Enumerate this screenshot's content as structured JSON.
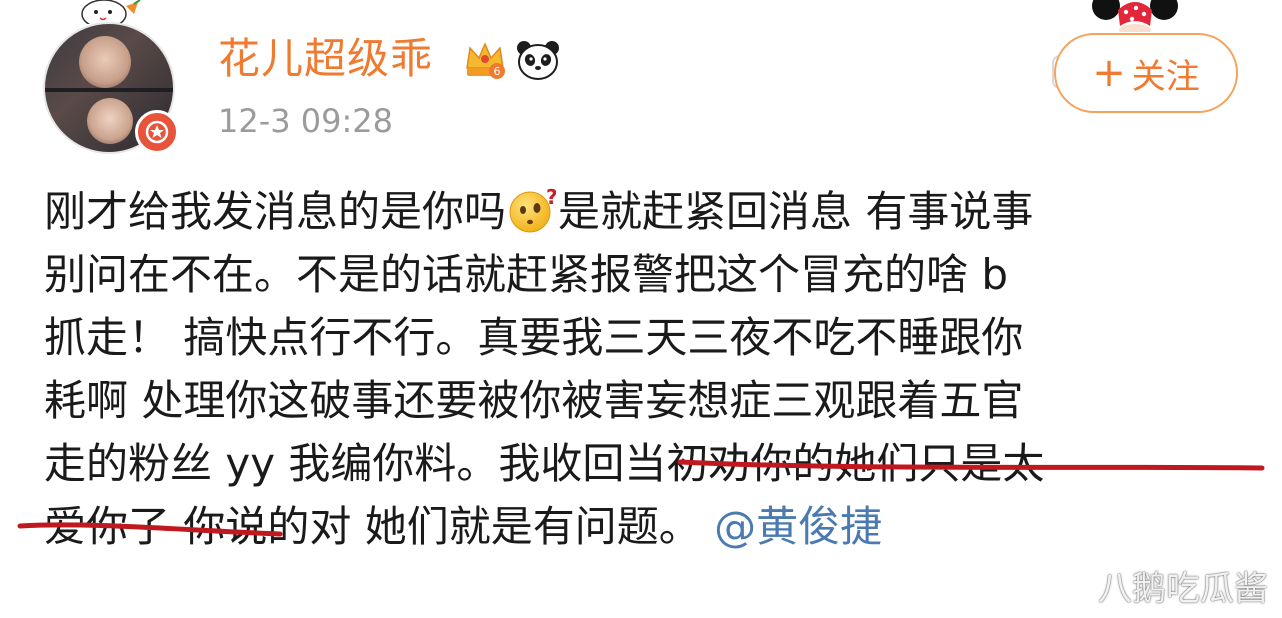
{
  "post": {
    "author": {
      "name": "花儿超级乖",
      "avatar_icon": "user-avatar",
      "badges": [
        "crown-level-6-icon",
        "panda-icon"
      ]
    },
    "timestamp": "12-3 09:28",
    "follow_button": {
      "plus": "+",
      "label": "关注"
    },
    "lines": [
      {
        "before": "刚才给我发消息的是你吗",
        "emoji": "thinking-face-icon",
        "after": "是就赶紧回消息 有事说事"
      },
      {
        "text": "别问在不在。不是的话就赶紧报警把这个冒充的啥 b"
      },
      {
        "text": "抓走！ 搞快点行不行。真要我三天三夜不吃不睡跟你"
      },
      {
        "text": "耗啊 处理你这破事还要被你被害妄想症三观跟着五官"
      },
      {
        "text": "走的粉丝 yy 我编你料。我收回当初劝你的她们只是太"
      },
      {
        "before": "爱你了 你说的对 她们就是有问题。",
        "mention": "@黄俊捷"
      }
    ]
  },
  "watermark": {
    "text": "八鹅吃瓜酱",
    "logo_icon": "weibo-logo-icon"
  },
  "colors": {
    "username": "#f07b30",
    "timestamp": "#9b9b9b",
    "mention": "#4a7ab0",
    "annotation": "#c0181f",
    "follow_border": "#f5a25d"
  }
}
